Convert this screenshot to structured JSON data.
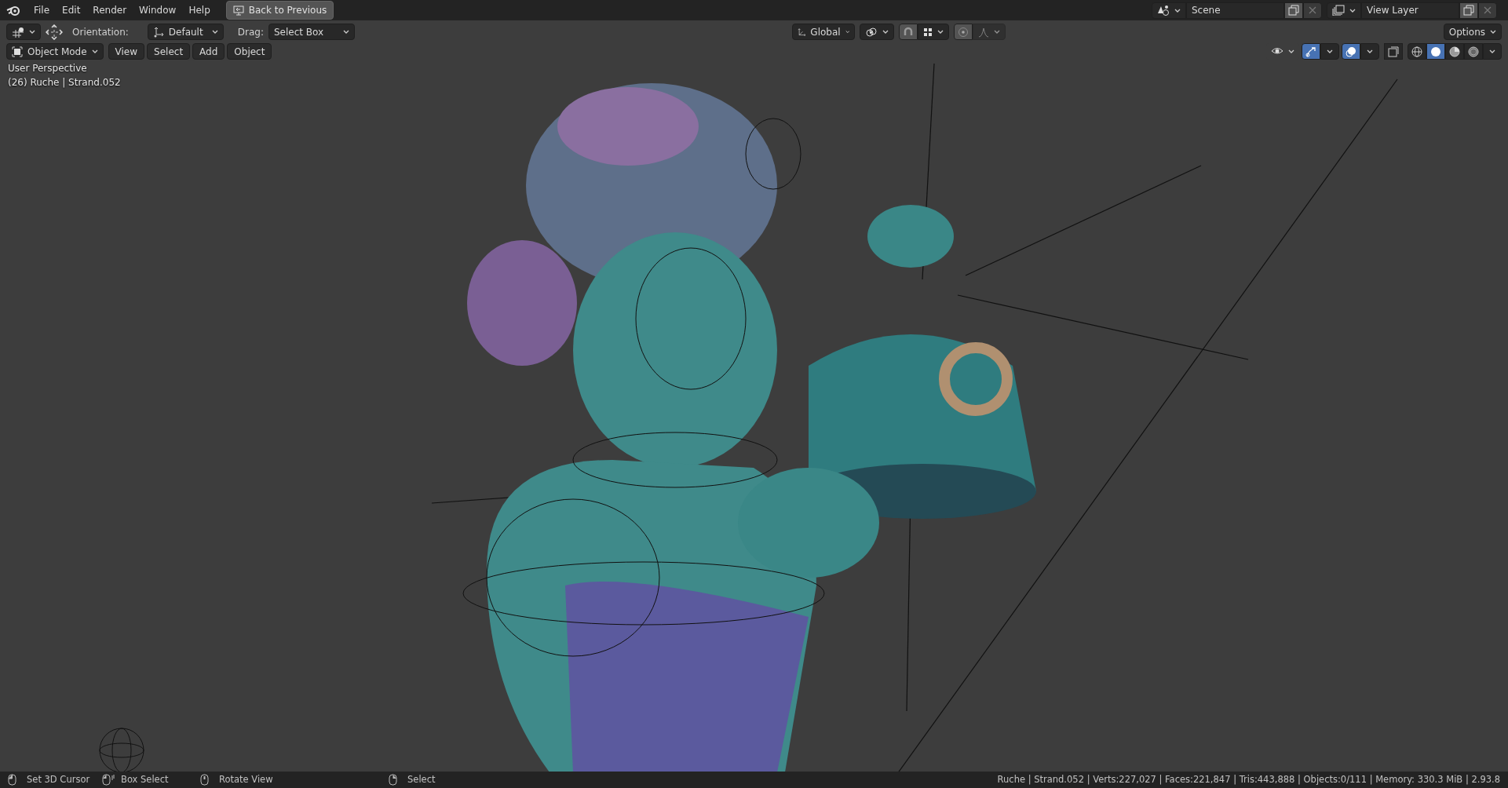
{
  "top_bar": {
    "menus": [
      "File",
      "Edit",
      "Render",
      "Window",
      "Help"
    ],
    "back_button": "Back to Previous",
    "scene": "Scene",
    "view_layer": "View Layer"
  },
  "tool_header": {
    "orientation_label": "Orientation:",
    "orientation": "Default",
    "drag_label": "Drag:",
    "drag": "Select Box",
    "transform_orientation": "Global",
    "options": "Options"
  },
  "viewport_header": {
    "mode": "Object Mode",
    "menus": [
      "View",
      "Select",
      "Add",
      "Object"
    ],
    "gizmos_on": true,
    "overlays_on": true,
    "shading": [
      {
        "kind": "wireframe",
        "selected": false
      },
      {
        "kind": "solid",
        "selected": true
      },
      {
        "kind": "material",
        "selected": false
      },
      {
        "kind": "rendered",
        "selected": false
      }
    ]
  },
  "viewport": {
    "view_name": "User Perspective",
    "object_info": "(26) Ruche | Strand.052"
  },
  "status_bar": {
    "hints": [
      {
        "kind": "left",
        "label": "Set 3D Cursor"
      },
      {
        "kind": "drag",
        "label": "Box Select"
      },
      {
        "kind": "middle",
        "label": "Rotate View"
      },
      {
        "kind": "right",
        "label": "Select"
      }
    ],
    "stats": "Ruche | Strand.052 | Verts:227,027 | Faces:221,847 | Tris:443,888 | Objects:0/111 | Memory: 330.3 MiB | 2.93.8"
  }
}
